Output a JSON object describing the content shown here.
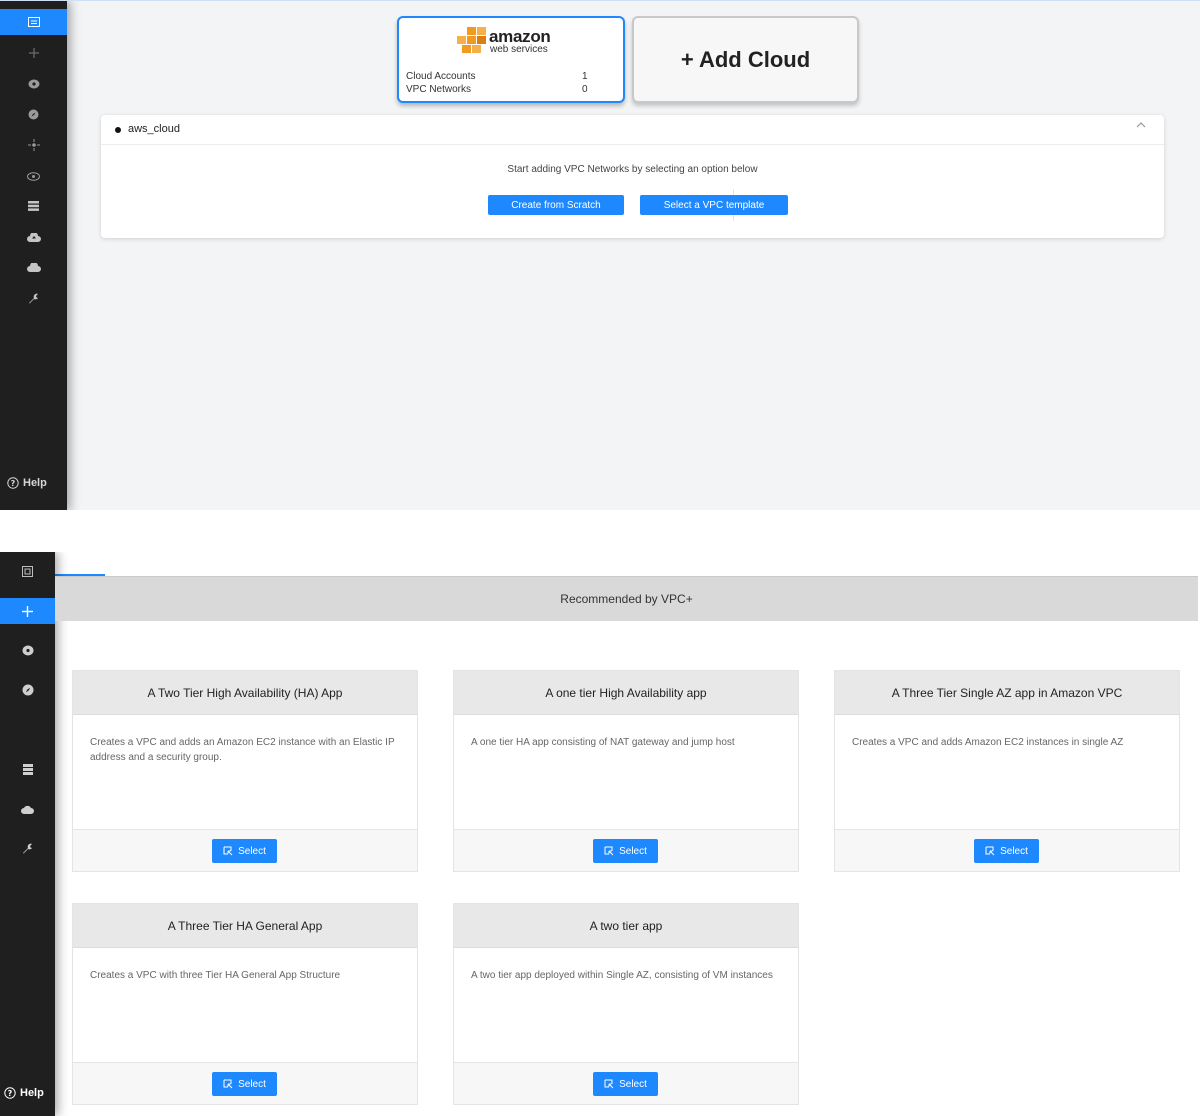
{
  "top": {
    "sidebar": {
      "items": [
        {
          "icon": "dashboard-icon",
          "active": true
        },
        {
          "icon": "plus-icon",
          "active": false
        },
        {
          "icon": "gauge-icon",
          "active": false
        },
        {
          "icon": "compass-icon",
          "active": false
        },
        {
          "icon": "network-icon",
          "active": false
        },
        {
          "icon": "eye-icon",
          "active": false
        },
        {
          "icon": "server-icon",
          "active": false
        },
        {
          "icon": "cloud-upload-icon",
          "active": false
        },
        {
          "icon": "cloud-icon",
          "active": false
        },
        {
          "icon": "wrench-icon",
          "active": false
        }
      ],
      "help_label": "Help"
    },
    "cloud_card": {
      "logo_main": "amazon",
      "logo_sub": "web services",
      "rows": [
        {
          "label": "Cloud Accounts",
          "value": "1"
        },
        {
          "label": "VPC Networks",
          "value": "0"
        }
      ]
    },
    "add_cloud_label": "+ Add Cloud",
    "panel": {
      "title": "aws_cloud",
      "message": "Start adding VPC Networks by selecting an option below",
      "create_label": "Create from Scratch",
      "template_label": "Select a VPC template"
    }
  },
  "bottom": {
    "sidebar": {
      "items": [
        {
          "icon": "dashboard-icon",
          "active": false
        },
        {
          "icon": "plus-icon",
          "active": true
        },
        {
          "icon": "gauge-icon",
          "active": false
        },
        {
          "icon": "compass-icon",
          "active": false
        },
        {
          "icon": "server-icon",
          "active": false
        },
        {
          "icon": "cloud-icon",
          "active": false
        },
        {
          "icon": "wrench-icon",
          "active": false
        }
      ],
      "help_label": "Help"
    },
    "recommended_label": "Recommended by VPC+",
    "select_label": "Select",
    "templates": [
      {
        "title": "A Two Tier High Availability (HA) App",
        "description": "Creates a VPC and adds an Amazon EC2 instance with an Elastic IP address and a security group."
      },
      {
        "title": "A one tier High Availability app",
        "description": "A one tier HA app consisting of NAT gateway and jump host"
      },
      {
        "title": "A Three Tier Single AZ app in Amazon VPC",
        "description": "Creates a VPC and adds Amazon EC2 instances in single AZ"
      },
      {
        "title": "A Three Tier HA General App",
        "description": "Creates a VPC with three Tier HA General App Structure"
      },
      {
        "title": "A two tier app",
        "description": "A two tier app deployed within Single AZ, consisting of VM instances"
      }
    ]
  },
  "colors": {
    "accent": "#1e88ff",
    "sidebar": "#1f1f1f",
    "aws_orange": "#f29a1f"
  }
}
